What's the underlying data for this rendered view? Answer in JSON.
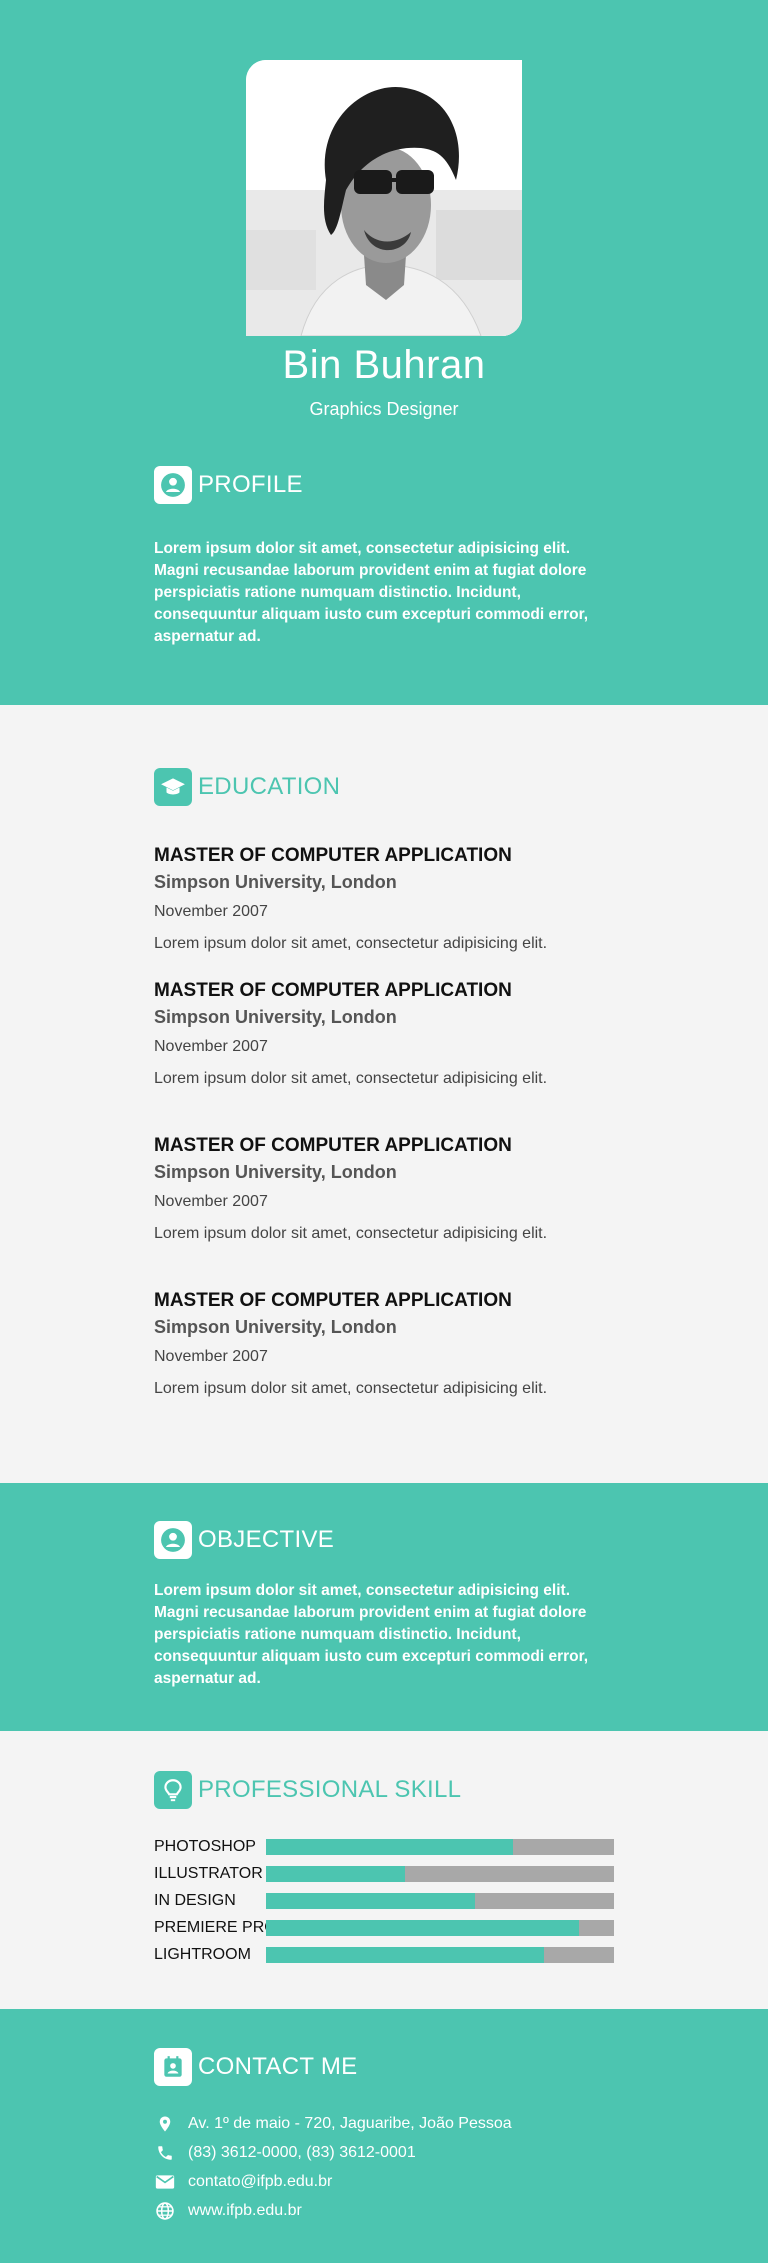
{
  "colors": {
    "accent": "#4cc5b0",
    "light_bg": "#f4f4f4",
    "bar_track": "#a8a8a8"
  },
  "header": {
    "name": "Bin Buhran",
    "title": "Graphics Designer",
    "photo_icon": "profile-photo"
  },
  "profile": {
    "heading": "PROFILE",
    "icon": "account-box-icon",
    "text": "Lorem ipsum dolor sit amet, consectetur adipisicing elit. Magni recusandae laborum provident enim at fugiat dolore perspiciatis ratione numquam distinctio. Incidunt, consequuntur aliquam iusto cum excepturi commodi error, aspernatur ad."
  },
  "education": {
    "heading": "EDUCATION",
    "icon": "graduation-cap-icon",
    "items": [
      {
        "degree": "MASTER OF COMPUTER APPLICATION",
        "school": "Simpson University, London",
        "date": "November 2007",
        "desc": "Lorem ipsum dolor sit amet, consectetur adipisicing elit."
      },
      {
        "degree": "MASTER OF COMPUTER APPLICATION",
        "school": "Simpson University, London",
        "date": "November 2007",
        "desc": "Lorem ipsum dolor sit amet, consectetur adipisicing elit."
      },
      {
        "degree": "MASTER OF COMPUTER APPLICATION",
        "school": "Simpson University, London",
        "date": "November 2007",
        "desc": "Lorem ipsum dolor sit amet, consectetur adipisicing elit."
      },
      {
        "degree": "MASTER OF COMPUTER APPLICATION",
        "school": "Simpson University, London",
        "date": "November 2007",
        "desc": "Lorem ipsum dolor sit amet, consectetur adipisicing elit."
      }
    ]
  },
  "objective": {
    "heading": "OBJECTIVE",
    "icon": "account-box-icon",
    "text": "Lorem ipsum dolor sit amet, consectetur adipisicing elit. Magni recusandae laborum provident enim at fugiat dolore perspiciatis ratione numquam distinctio. Incidunt, consequuntur aliquam iusto cum excepturi commodi error, aspernatur ad."
  },
  "skills": {
    "heading": "PROFESSIONAL SKILL",
    "icon": "lightbulb-icon",
    "items": [
      {
        "name": "PHOTOSHOP",
        "level": 0.71
      },
      {
        "name": "ILLUSTRATOR",
        "level": 0.4
      },
      {
        "name": "IN DESIGN",
        "level": 0.6
      },
      {
        "name": "PREMIERE PRO",
        "level": 0.9
      },
      {
        "name": "LIGHTROOM",
        "level": 0.8
      }
    ]
  },
  "contact": {
    "heading": "CONTACT ME",
    "icon": "contact-card-icon",
    "items": [
      {
        "icon": "location-pin-icon",
        "text": "Av. 1º de maio - 720, Jaguaribe, João Pessoa"
      },
      {
        "icon": "phone-icon",
        "text": "(83) 3612-0000, (83) 3612-0001"
      },
      {
        "icon": "mail-icon",
        "text": "contato@ifpb.edu.br"
      },
      {
        "icon": "globe-icon",
        "text": "www.ifpb.edu.br"
      }
    ]
  }
}
